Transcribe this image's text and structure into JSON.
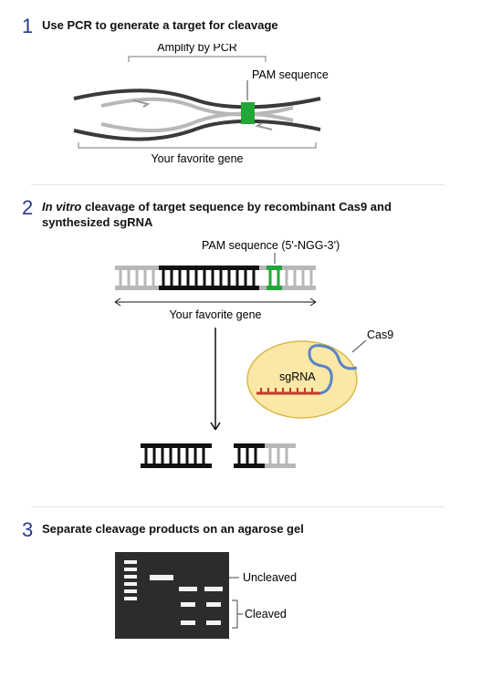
{
  "steps": [
    {
      "num": "1",
      "title_plain": "Use PCR to generate a target for cleavage",
      "labels": {
        "amplify": "Amplify by PCR",
        "pam": "PAM sequence",
        "gene": "Your favorite gene"
      }
    },
    {
      "num": "2",
      "title_italic": "In vitro",
      "title_rest": " cleavage of target sequence by recombinant Cas9 and synthesized sgRNA",
      "labels": {
        "pam_ngg": "PAM sequence (5'-NGG-3')",
        "gene": "Your favorite gene",
        "sgrna": "sgRNA",
        "cas9": "Cas9"
      }
    },
    {
      "num": "3",
      "title_plain": "Separate cleavage products on an agarose gel",
      "labels": {
        "uncleaved": "Uncleaved",
        "cleaved": "Cleaved"
      }
    }
  ]
}
